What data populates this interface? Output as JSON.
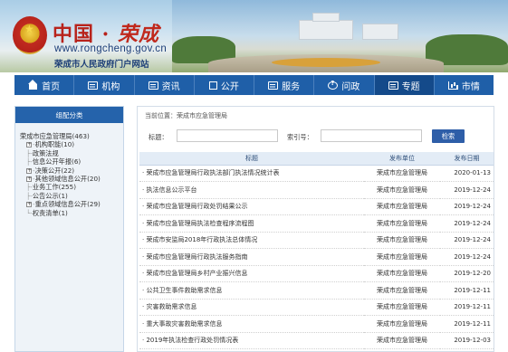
{
  "header": {
    "title_prefix": "中国 · ",
    "title_city": "荣成",
    "url": "www.rongcheng.gov.cn",
    "subtitle": "荣成市人民政府门户网站"
  },
  "nav": {
    "items": [
      {
        "label": "首页",
        "icon": "home-icon"
      },
      {
        "label": "机构",
        "icon": "org-icon"
      },
      {
        "label": "资讯",
        "icon": "news-icon"
      },
      {
        "label": "公开",
        "icon": "doc-icon"
      },
      {
        "label": "服务",
        "icon": "service-icon"
      },
      {
        "label": "问政",
        "icon": "question-icon"
      },
      {
        "label": "专题",
        "icon": "topic-icon"
      },
      {
        "label": "市情",
        "icon": "city-icon"
      }
    ],
    "active": "专题"
  },
  "sidebar": {
    "heading": "组配分类",
    "tree": [
      {
        "label": "荣成市应急管理局(463)",
        "level": 0,
        "toggle": ""
      },
      {
        "label": "机构职能(10)",
        "level": 1,
        "toggle": "+"
      },
      {
        "label": "政策法规",
        "level": 1,
        "toggle": ""
      },
      {
        "label": "信息公开年报(6)",
        "level": 1,
        "toggle": ""
      },
      {
        "label": "决策公开(22)",
        "level": 1,
        "toggle": "+"
      },
      {
        "label": "其他领域信息公开(20)",
        "level": 1,
        "toggle": "+"
      },
      {
        "label": "业务工作(255)",
        "level": 1,
        "toggle": ""
      },
      {
        "label": "公告公示(1)",
        "level": 1,
        "toggle": ""
      },
      {
        "label": "重点领域信息公开(29)",
        "level": 1,
        "toggle": "+"
      },
      {
        "label": "权责清单(1)",
        "level": 1,
        "toggle": ""
      }
    ]
  },
  "main": {
    "breadcrumb": "当前位置：荣成市应急管理局",
    "search": {
      "title_label": "标题：",
      "index_label": "索引号：",
      "button_label": "检索",
      "title_value": "",
      "index_value": ""
    },
    "table": {
      "headers": [
        "标题",
        "发布单位",
        "发布日期"
      ],
      "rows": [
        {
          "title": "荣成市应急管理局行政执法部门执法情况统计表",
          "unit": "荣成市应急管理局",
          "date": "2020-01-13"
        },
        {
          "title": "执法信息公示平台",
          "unit": "荣成市应急管理局",
          "date": "2019-12-24"
        },
        {
          "title": "荣成市应急管理局行政处罚结果公示",
          "unit": "荣成市应急管理局",
          "date": "2019-12-24"
        },
        {
          "title": "荣成市应急管理局执法检查程序流程图",
          "unit": "荣成市应急管理局",
          "date": "2019-12-24"
        },
        {
          "title": "荣成市安监局2018年行政执法总体情况",
          "unit": "荣成市应急管理局",
          "date": "2019-12-24"
        },
        {
          "title": "荣成市应急管理局行政执法服务指南",
          "unit": "荣成市应急管理局",
          "date": "2019-12-24"
        },
        {
          "title": "荣成市应急管理局乡村产业振兴信息",
          "unit": "荣成市应急管理局",
          "date": "2019-12-20"
        },
        {
          "title": "公共卫生事件救助需求信息",
          "unit": "荣成市应急管理局",
          "date": "2019-12-11"
        },
        {
          "title": "灾害救助需求信息",
          "unit": "荣成市应急管理局",
          "date": "2019-12-11"
        },
        {
          "title": "重大事故灾害救助需求信息",
          "unit": "荣成市应急管理局",
          "date": "2019-12-11"
        },
        {
          "title": "2019年执法检查行政处罚情况表",
          "unit": "荣成市应急管理局",
          "date": "2019-12-03"
        }
      ]
    }
  },
  "colors": {
    "nav_bg": "#1f5fa8",
    "nav_active": "#144a8a",
    "title_red": "#b8231b",
    "url_blue": "#1d3f78",
    "button_blue": "#2e5ea8"
  }
}
